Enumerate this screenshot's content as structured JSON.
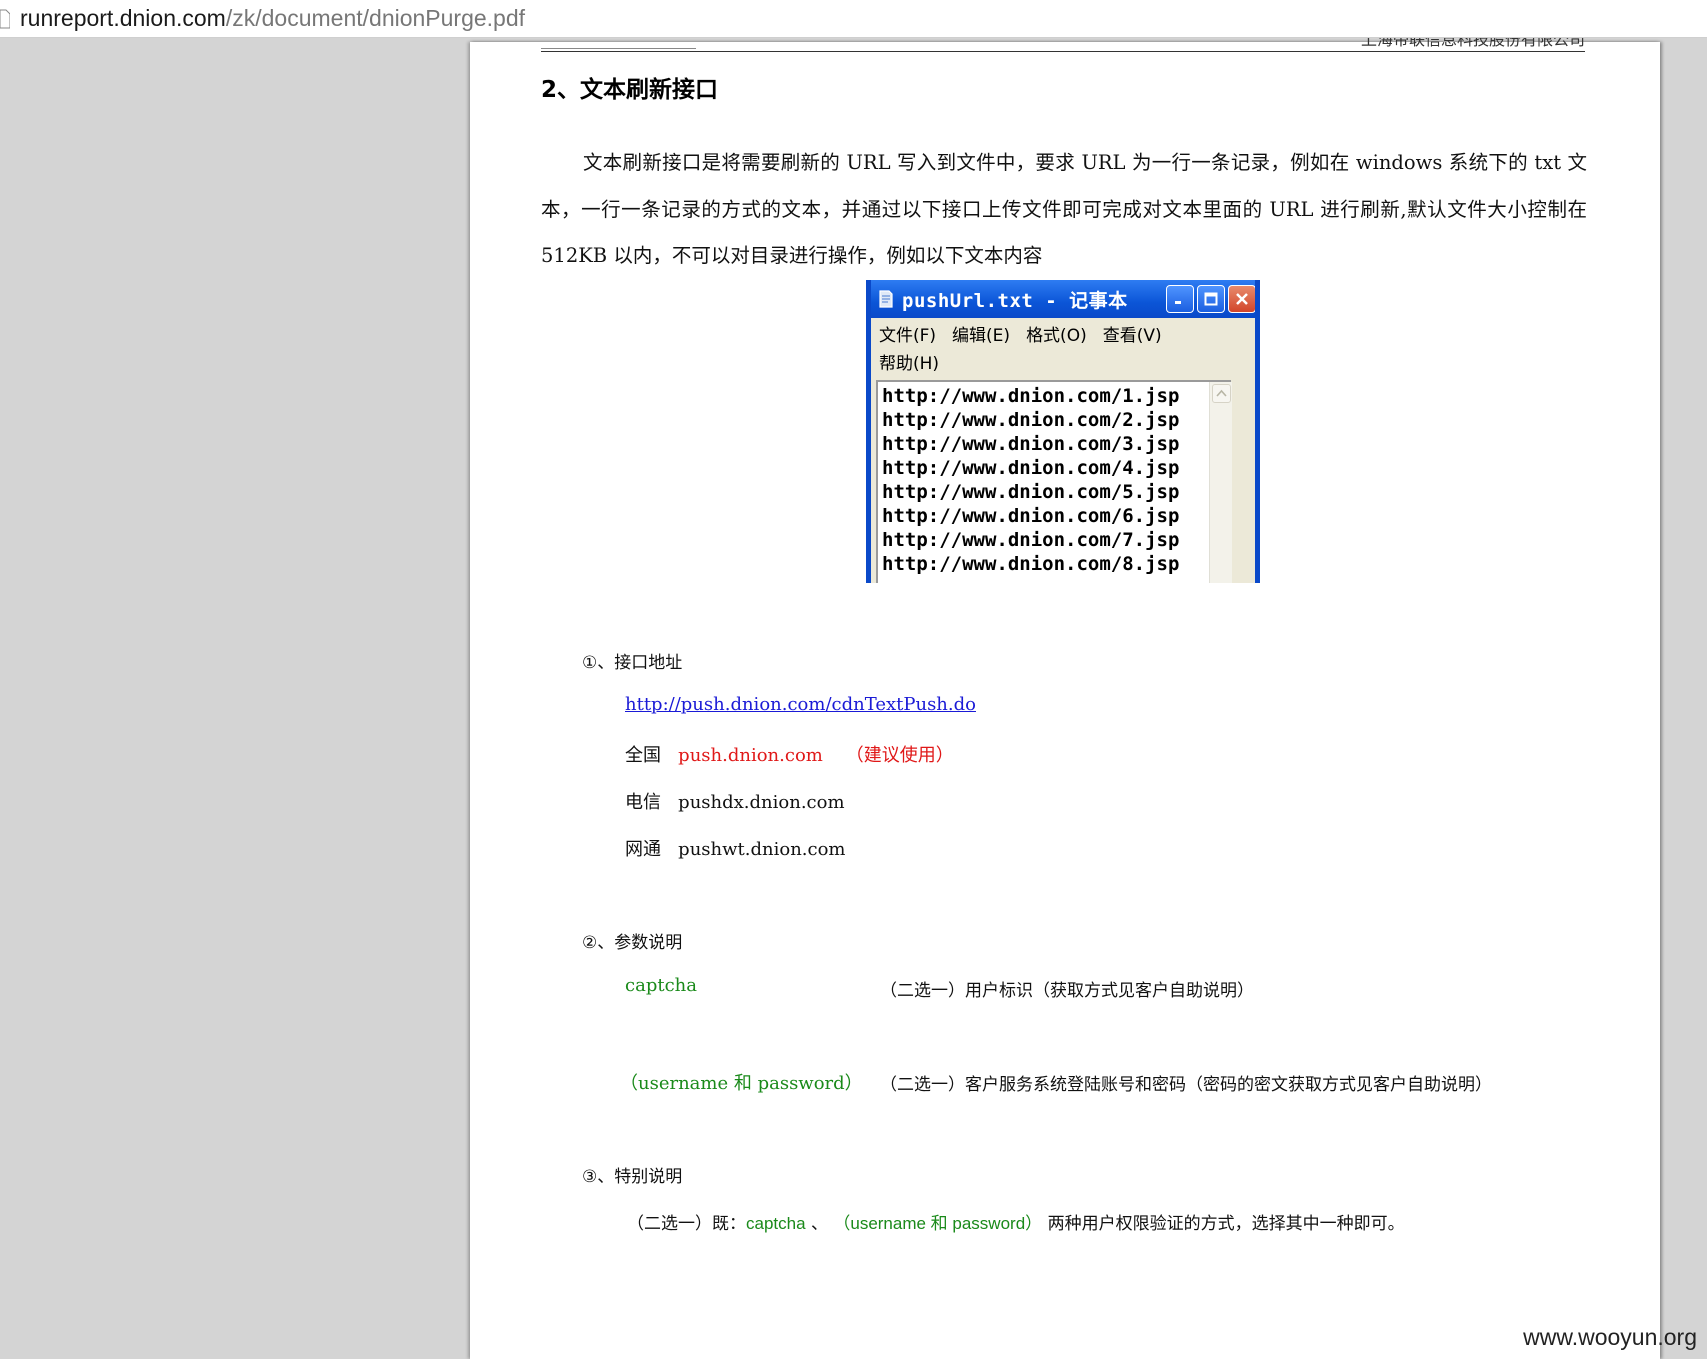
{
  "browser": {
    "url_host": "runreport.dnion.com",
    "url_path": "/zk/document/dnionPurge.pdf"
  },
  "document": {
    "header_company": "上海帝联信息科技股份有限公司",
    "section_title": "2、文本刷新接口",
    "intro": "文本刷新接口是将需要刷新的 URL 写入到文件中，要求 URL 为一行一条记录，例如在 windows 系统下的 txt 文本，一行一条记录的方式的文本，并通过以下接口上传文件即可完成对文本里面的 URL 进行刷新,默认文件大小控制在 512KB 以内，不可以对目录进行操作，例如以下文本内容",
    "notepad": {
      "title": "pushUrl.txt - 记事本",
      "menu": [
        "文件(F)",
        "编辑(E)",
        "格式(O)",
        "查看(V)",
        "帮助(H)"
      ],
      "lines": [
        "http://www.dnion.com/1.jsp",
        "http://www.dnion.com/2.jsp",
        "http://www.dnion.com/3.jsp",
        "http://www.dnion.com/4.jsp",
        "http://www.dnion.com/5.jsp",
        "http://www.dnion.com/6.jsp",
        "http://www.dnion.com/7.jsp",
        "http://www.dnion.com/8.jsp"
      ]
    },
    "item1": {
      "head": "①、接口地址",
      "link": "http://push.dnion.com/cdnTextPush.do",
      "rows": [
        {
          "label": "全国",
          "host": "push.dnion.com",
          "note": "（建议使用）"
        },
        {
          "label": "电信",
          "host": "pushdx.dnion.com"
        },
        {
          "label": "网通",
          "host": "pushwt.dnion.com"
        }
      ]
    },
    "item2": {
      "head": "②、参数说明",
      "params": [
        {
          "name": "captcha",
          "desc": "（二选一）用户标识（获取方式见客户自助说明）"
        },
        {
          "name": "（username 和 password）",
          "desc": "（二选一）客户服务系统登陆账号和密码（密码的密文获取方式见客户自助说明）"
        }
      ]
    },
    "item3": {
      "head": "③、特别说明",
      "prefix": "（二选一）既：",
      "p1": "captcha",
      "sep": " 、 ",
      "p2": "（username 和 password）",
      "suffix": " 两种用户权限验证的方式，选择其中一种即可。"
    }
  },
  "watermark": "www.wooyun.org"
}
